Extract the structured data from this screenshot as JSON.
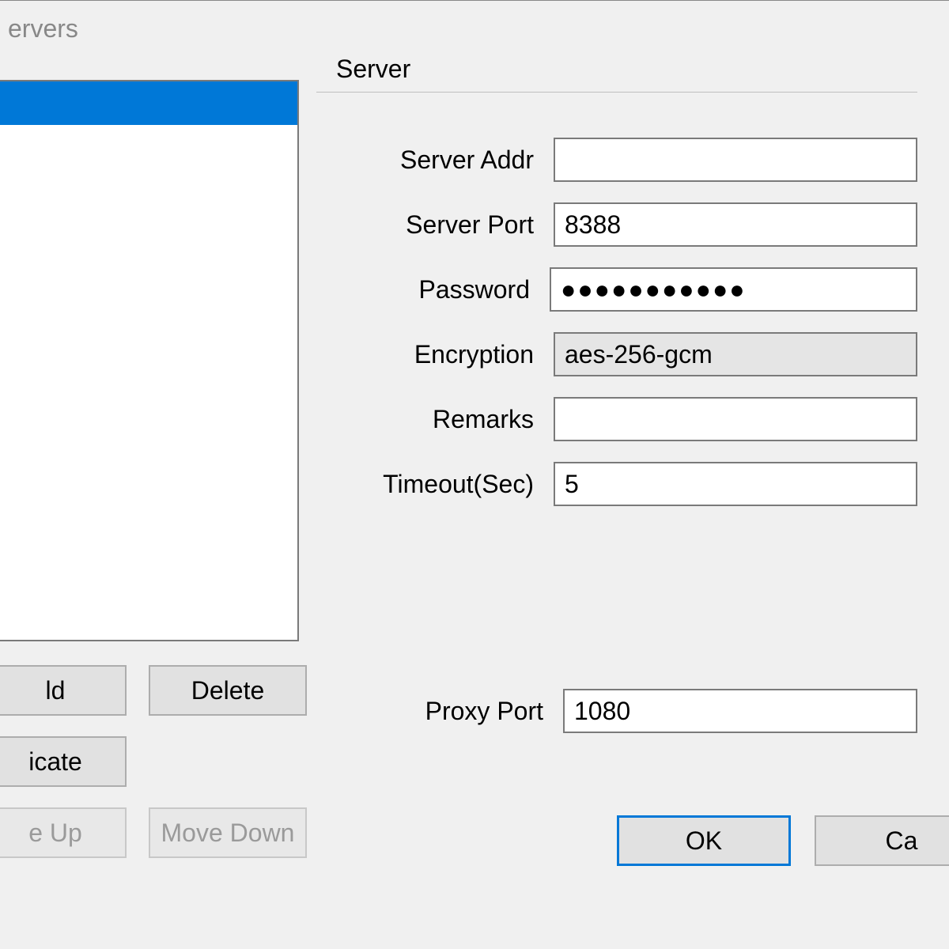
{
  "window": {
    "title": "ervers"
  },
  "server_group": {
    "legend": "Server",
    "labels": {
      "addr": "Server Addr",
      "port": "Server Port",
      "password": "Password",
      "encryption": "Encryption",
      "remarks": "Remarks",
      "timeout": "Timeout(Sec)"
    },
    "values": {
      "addr": "",
      "port": "8388",
      "password": "●●●●●●●●●●●",
      "encryption": "aes-256-gcm",
      "remarks": "",
      "timeout": "5"
    }
  },
  "buttons": {
    "add": "ld",
    "delete": "Delete",
    "duplicate": "icate",
    "move_up": "e Up",
    "move_down": "Move Down"
  },
  "proxy": {
    "label": "Proxy Port",
    "value": "1080"
  },
  "dialog": {
    "ok": "OK",
    "cancel": "Ca"
  }
}
